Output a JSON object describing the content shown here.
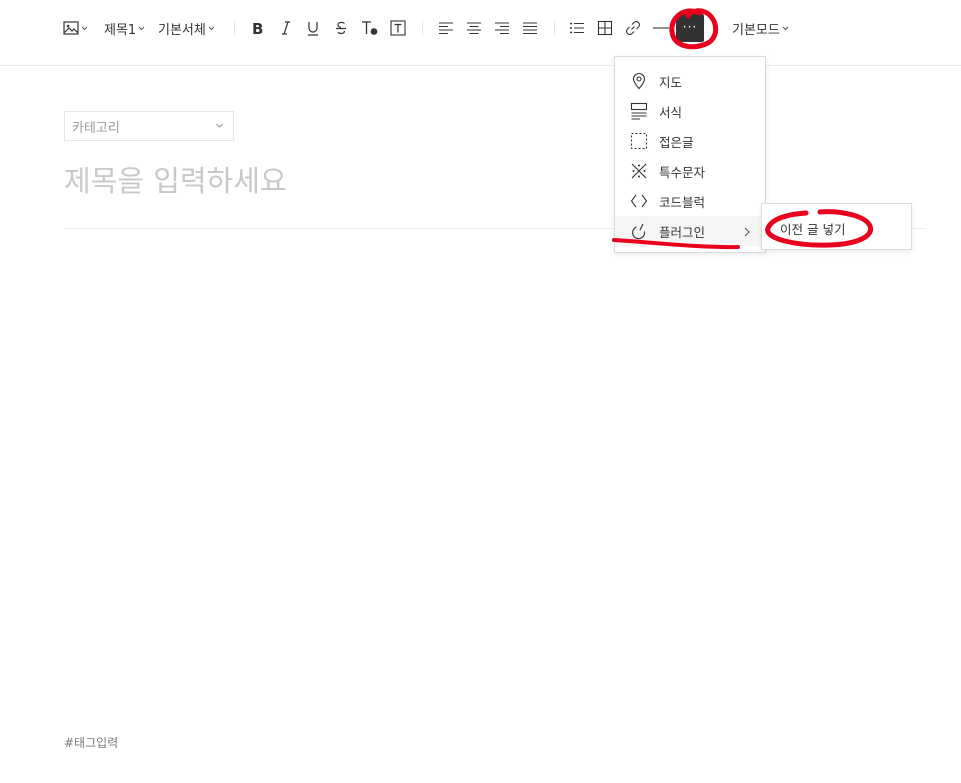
{
  "toolbar": {
    "heading_label": "제목1",
    "font_label": "기본서체",
    "mode_label": "기본모드",
    "more_label": "···"
  },
  "editor": {
    "category_placeholder": "카테고리",
    "title_placeholder": "제목을 입력하세요",
    "tag_placeholder": "#태그입력"
  },
  "more_menu": {
    "items": [
      {
        "label": "지도",
        "icon": "map-pin-icon"
      },
      {
        "label": "서식",
        "icon": "template-icon"
      },
      {
        "label": "접은글",
        "icon": "fold-box-icon"
      },
      {
        "label": "특수문자",
        "icon": "special-char-icon"
      },
      {
        "label": "코드블럭",
        "icon": "code-icon"
      },
      {
        "label": "플러그인",
        "icon": "plugin-icon"
      }
    ],
    "active_item": "플러그인"
  },
  "plugin_submenu": {
    "items": [
      {
        "label": "이전 글 넣기"
      }
    ]
  },
  "colors": {
    "annotation": "#e8001c",
    "more_button_bg": "#333333",
    "placeholder": "#c8c8c8"
  }
}
